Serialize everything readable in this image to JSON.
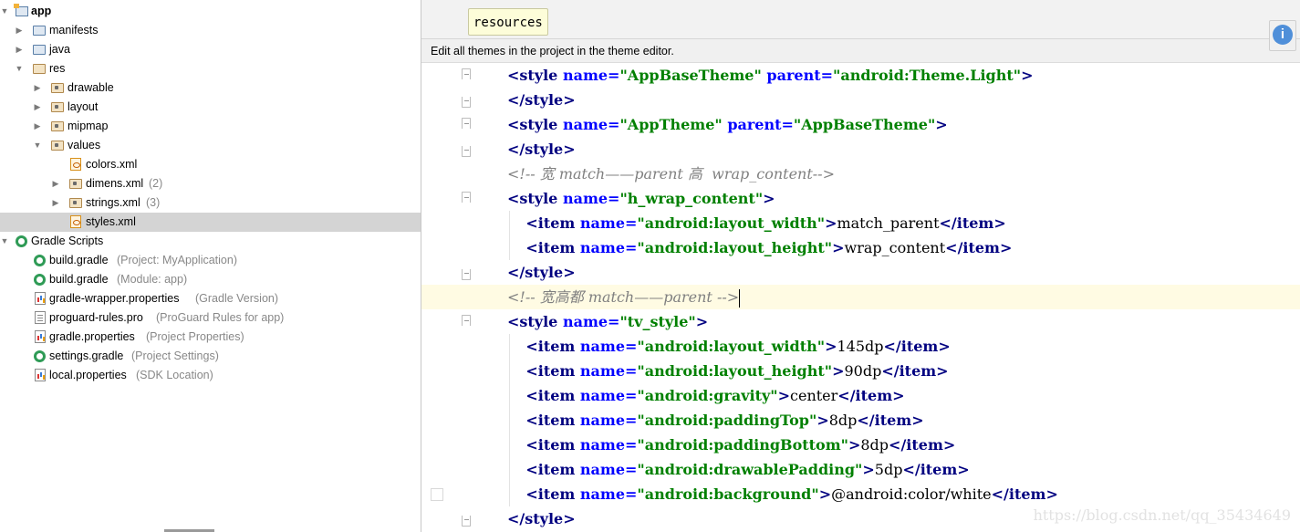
{
  "project_tree": {
    "items": [
      {
        "label": "app",
        "hint": "",
        "icon": "module-icon",
        "bold": true
      },
      {
        "label": "manifests",
        "hint": "",
        "icon": "folder-icon"
      },
      {
        "label": "java",
        "hint": "",
        "icon": "folder-icon"
      },
      {
        "label": "res",
        "hint": "",
        "icon": "res-folder-icon"
      },
      {
        "label": "drawable",
        "hint": "",
        "icon": "package-folder-icon"
      },
      {
        "label": "layout",
        "hint": "",
        "icon": "package-folder-icon"
      },
      {
        "label": "mipmap",
        "hint": "",
        "icon": "package-folder-icon"
      },
      {
        "label": "values",
        "hint": "",
        "icon": "package-folder-icon"
      },
      {
        "label": "colors.xml",
        "hint": "",
        "icon": "xml-file-icon"
      },
      {
        "label": "dimens.xml",
        "hint": "(2)",
        "icon": "package-folder-icon"
      },
      {
        "label": "strings.xml",
        "hint": "(3)",
        "icon": "package-folder-icon"
      },
      {
        "label": "styles.xml",
        "hint": "",
        "icon": "xml-file-icon",
        "selected": true
      },
      {
        "label": "Gradle Scripts",
        "hint": "",
        "icon": "gradle-icon"
      },
      {
        "label": "build.gradle",
        "hint": "(Project: MyApplication)",
        "icon": "gradle-icon"
      },
      {
        "label": "build.gradle",
        "hint": "(Module: app)",
        "icon": "gradle-icon"
      },
      {
        "label": "gradle-wrapper.properties",
        "hint": "(Gradle Version)",
        "icon": "properties-icon"
      },
      {
        "label": "proguard-rules.pro",
        "hint": "(ProGuard Rules for app)",
        "icon": "text-file-icon"
      },
      {
        "label": "gradle.properties",
        "hint": "(Project Properties)",
        "icon": "properties-icon"
      },
      {
        "label": "settings.gradle",
        "hint": "(Project Settings)",
        "icon": "gradle-icon"
      },
      {
        "label": "local.properties",
        "hint": "(SDK Location)",
        "icon": "properties-icon"
      }
    ]
  },
  "editor": {
    "tab_label": "resources",
    "banner_text": "Edit all themes in the project in the theme editor.",
    "notification_icon": "i",
    "watermark": "https://blog.csdn.net/qq_35434649",
    "colors": {
      "tag": "#000080",
      "attr": "#0000ff",
      "string": "#008000",
      "comment": "#808080",
      "current_line": "#fffbe3"
    }
  },
  "code": {
    "lines": [
      [
        {
          "t": "tg",
          "v": "<style "
        },
        {
          "t": "at",
          "v": "name="
        },
        {
          "t": "st",
          "v": "\"AppBaseTheme\""
        },
        {
          "t": "at",
          "v": " parent="
        },
        {
          "t": "st",
          "v": "\"android:Theme.Light\""
        },
        {
          "t": "tg",
          "v": ">"
        }
      ],
      [
        {
          "t": "tg",
          "v": "</style>"
        }
      ],
      [
        {
          "t": "tg",
          "v": "<style "
        },
        {
          "t": "at",
          "v": "name="
        },
        {
          "t": "st",
          "v": "\"AppTheme\""
        },
        {
          "t": "at",
          "v": " parent="
        },
        {
          "t": "st",
          "v": "\"AppBaseTheme\""
        },
        {
          "t": "tg",
          "v": ">"
        }
      ],
      [
        {
          "t": "tg",
          "v": "</style>"
        }
      ],
      [
        {
          "t": "cm",
          "v": "<!-- 宽 match——parent 高  wrap_content-->"
        }
      ],
      [
        {
          "t": "tg",
          "v": "<style "
        },
        {
          "t": "at",
          "v": "name="
        },
        {
          "t": "st",
          "v": "\"h_wrap_content\""
        },
        {
          "t": "tg",
          "v": ">"
        }
      ],
      [
        {
          "t": "tx",
          "v": "    "
        },
        {
          "t": "tg",
          "v": "<item "
        },
        {
          "t": "at",
          "v": "name="
        },
        {
          "t": "st",
          "v": "\"android:layout_width\""
        },
        {
          "t": "tg",
          "v": ">"
        },
        {
          "t": "tx",
          "v": "match_parent"
        },
        {
          "t": "tg",
          "v": "</item>"
        }
      ],
      [
        {
          "t": "tx",
          "v": "    "
        },
        {
          "t": "tg",
          "v": "<item "
        },
        {
          "t": "at",
          "v": "name="
        },
        {
          "t": "st",
          "v": "\"android:layout_height\""
        },
        {
          "t": "tg",
          "v": ">"
        },
        {
          "t": "tx",
          "v": "wrap_content"
        },
        {
          "t": "tg",
          "v": "</item>"
        }
      ],
      [
        {
          "t": "tg",
          "v": "</style>"
        }
      ],
      [
        {
          "t": "cm",
          "v": "<!-- 宽高都 match——parent -->"
        }
      ],
      [
        {
          "t": "tg",
          "v": "<style "
        },
        {
          "t": "at",
          "v": "name="
        },
        {
          "t": "st",
          "v": "\"tv_style\""
        },
        {
          "t": "tg",
          "v": ">"
        }
      ],
      [
        {
          "t": "tx",
          "v": "    "
        },
        {
          "t": "tg",
          "v": "<item "
        },
        {
          "t": "at",
          "v": "name="
        },
        {
          "t": "st",
          "v": "\"android:layout_width\""
        },
        {
          "t": "tg",
          "v": ">"
        },
        {
          "t": "tx",
          "v": "145dp"
        },
        {
          "t": "tg",
          "v": "</item>"
        }
      ],
      [
        {
          "t": "tx",
          "v": "    "
        },
        {
          "t": "tg",
          "v": "<item "
        },
        {
          "t": "at",
          "v": "name="
        },
        {
          "t": "st",
          "v": "\"android:layout_height\""
        },
        {
          "t": "tg",
          "v": ">"
        },
        {
          "t": "tx",
          "v": "90dp"
        },
        {
          "t": "tg",
          "v": "</item>"
        }
      ],
      [
        {
          "t": "tx",
          "v": "    "
        },
        {
          "t": "tg",
          "v": "<item "
        },
        {
          "t": "at",
          "v": "name="
        },
        {
          "t": "st",
          "v": "\"android:gravity\""
        },
        {
          "t": "tg",
          "v": ">"
        },
        {
          "t": "tx",
          "v": "center"
        },
        {
          "t": "tg",
          "v": "</item>"
        }
      ],
      [
        {
          "t": "tx",
          "v": "    "
        },
        {
          "t": "tg",
          "v": "<item "
        },
        {
          "t": "at",
          "v": "name="
        },
        {
          "t": "st",
          "v": "\"android:paddingTop\""
        },
        {
          "t": "tg",
          "v": ">"
        },
        {
          "t": "tx",
          "v": "8dp"
        },
        {
          "t": "tg",
          "v": "</item>"
        }
      ],
      [
        {
          "t": "tx",
          "v": "    "
        },
        {
          "t": "tg",
          "v": "<item "
        },
        {
          "t": "at",
          "v": "name="
        },
        {
          "t": "st",
          "v": "\"android:paddingBottom\""
        },
        {
          "t": "tg",
          "v": ">"
        },
        {
          "t": "tx",
          "v": "8dp"
        },
        {
          "t": "tg",
          "v": "</item>"
        }
      ],
      [
        {
          "t": "tx",
          "v": "    "
        },
        {
          "t": "tg",
          "v": "<item "
        },
        {
          "t": "at",
          "v": "name="
        },
        {
          "t": "st",
          "v": "\"android:drawablePadding\""
        },
        {
          "t": "tg",
          "v": ">"
        },
        {
          "t": "tx",
          "v": "5dp"
        },
        {
          "t": "tg",
          "v": "</item>"
        }
      ],
      [
        {
          "t": "tx",
          "v": "    "
        },
        {
          "t": "tg",
          "v": "<item "
        },
        {
          "t": "at",
          "v": "name="
        },
        {
          "t": "st",
          "v": "\"android:background\""
        },
        {
          "t": "tg",
          "v": ">"
        },
        {
          "t": "tx",
          "v": "@android:color/white"
        },
        {
          "t": "tg",
          "v": "</item>"
        }
      ],
      [
        {
          "t": "tg",
          "v": "</style>"
        }
      ]
    ]
  }
}
